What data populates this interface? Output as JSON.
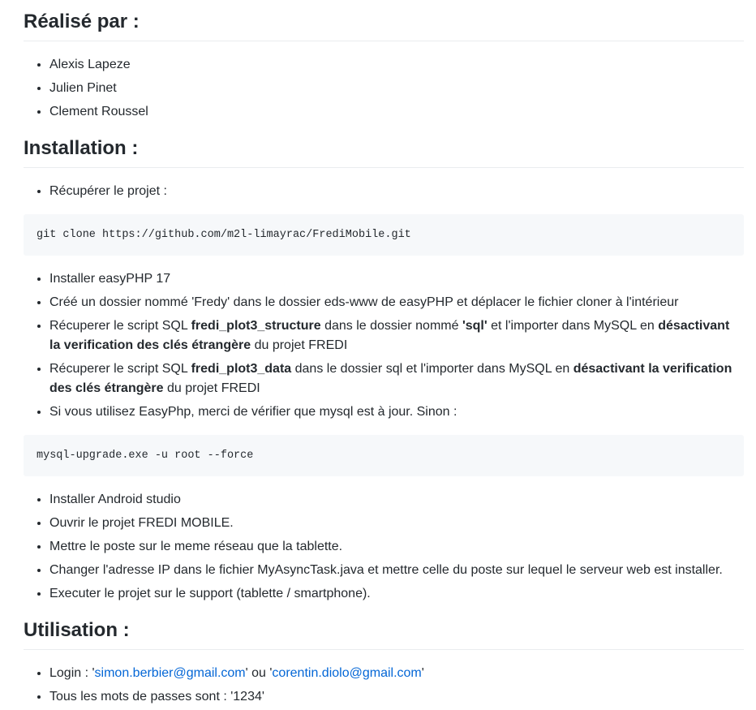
{
  "sections": {
    "authors": {
      "title": "Réalisé par :",
      "items": [
        "Alexis Lapeze",
        "Julien Pinet",
        "Clement Roussel"
      ]
    },
    "installation": {
      "title": "Installation :",
      "step1": "Récupérer le projet :",
      "code1": "git clone https://github.com/m2l-limayrac/FrediMobile.git",
      "step2": "Installer easyPHP 17",
      "step3": "Créé un dossier nommé 'Fredy' dans le dossier eds-www de easyPHP et déplacer le fichier cloner à l'intérieur",
      "step4": {
        "t1": "Récuperer le script SQL ",
        "b1": "fredi_plot3_structure",
        "t2": " dans le dossier nommé ",
        "b2": "'sql'",
        "t3": " et l'importer dans MySQL en ",
        "b3": "désactivant la verification des clés étrangère",
        "t4": " du projet FREDI"
      },
      "step5": {
        "t1": "Récuperer le script SQL ",
        "b1": "fredi_plot3_data",
        "t2": " dans le dossier sql et l'importer dans MySQL en ",
        "b2": "désactivant la verification des clés étrangère",
        "t3": " du projet FREDI"
      },
      "step6": "Si vous utilisez EasyPhp, merci de vérifier que mysql est à jour. Sinon :",
      "code2": "mysql-upgrade.exe -u root --force",
      "steps_after": [
        "Installer Android studio",
        "Ouvrir le projet FREDI MOBILE.",
        "Mettre le poste sur le meme réseau que la tablette.",
        "Changer l'adresse IP dans le fichier MyAsyncTask.java et mettre celle du poste sur lequel le serveur web est installer.",
        "Executer le projet sur le support (tablette / smartphone)."
      ]
    },
    "usage": {
      "title": "Utilisation :",
      "login_label": "Login : '",
      "email1": "simon.berbier@gmail.com",
      "login_mid": "' ou '",
      "email2": "corentin.diolo@gmail.com",
      "login_end": "'",
      "passwords": "Tous les mots de passes sont : '1234'"
    }
  }
}
